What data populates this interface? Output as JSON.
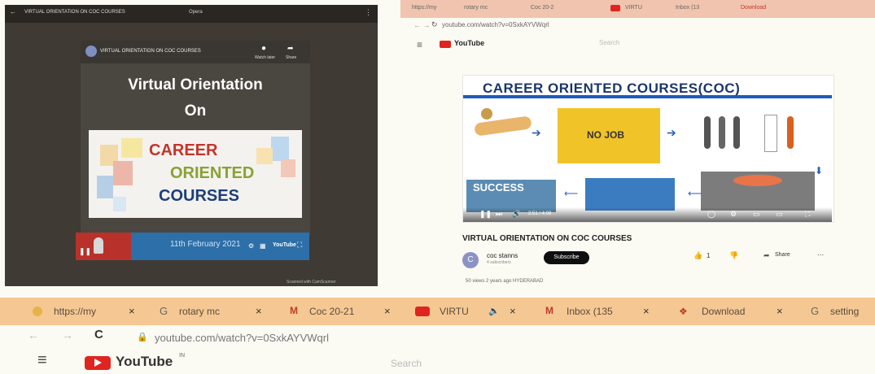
{
  "left_panel": {
    "window_title": "VIRTUAL ORIENTATION ON COC COURSES",
    "topbar_extra": "Opera",
    "video_title": "VIRTUAL ORIENTATION ON COC COURSES",
    "watch_later": "Watch later",
    "share": "Share",
    "heading_line1": "Virtual Orientation",
    "heading_line2": "On",
    "career": "CAREER",
    "oriented": "ORIENTED",
    "courses": "COURSES",
    "date_text": "11th February 2021",
    "footer_text": "Scanned with CamScanner"
  },
  "right_browser": {
    "tabs": [
      "https://my",
      "rotary mc",
      "Coc 20-2",
      "VIRTU",
      "Inbox (13",
      "Download"
    ],
    "url": "youtube.com/watch?v=0SxkAYVWqrl",
    "youtube": "YouTube",
    "search_placeholder": "Search",
    "thumb_title": "CAREER ORIENTED COURSES(COC)",
    "nojob_text": "NO JOB",
    "success_text": "SUCCESS",
    "time_text": "2:51 / 4:08",
    "video_title": "VIRTUAL ORIENTATION ON COC COURSES",
    "channel_initial": "C",
    "channel_name": "coc stanns",
    "subscribers": "4 subscribers",
    "subscribe": "Subscribe",
    "likes": "1",
    "share": "Share",
    "more": "...",
    "meta": "50 views  2 years ago  HYDERABAD"
  },
  "bottom_browser": {
    "tabs": [
      {
        "label": "https://my",
        "icon": "globe-icon"
      },
      {
        "label": "rotary mc",
        "icon": "google-icon"
      },
      {
        "label": "Coc 20-21",
        "icon": "gmail-icon"
      },
      {
        "label": "VIRTU",
        "icon": "youtube-icon"
      },
      {
        "label": "Inbox (135",
        "icon": "gmail-icon"
      },
      {
        "label": "Download",
        "icon": "download-icon"
      },
      {
        "label": "setting",
        "icon": "google-icon"
      }
    ],
    "close": "×",
    "back": "←",
    "forward": "→",
    "reload": "C",
    "url": "youtube.com/watch?v=0SxkAYVWqrl",
    "menu": "≡",
    "youtube": "YouTube",
    "region": "IN",
    "search_placeholder": "Search"
  },
  "colors": {
    "youtube_red": "#e0241f",
    "thumb_blue": "#1b3668",
    "tab_bar": "#f5c893"
  }
}
